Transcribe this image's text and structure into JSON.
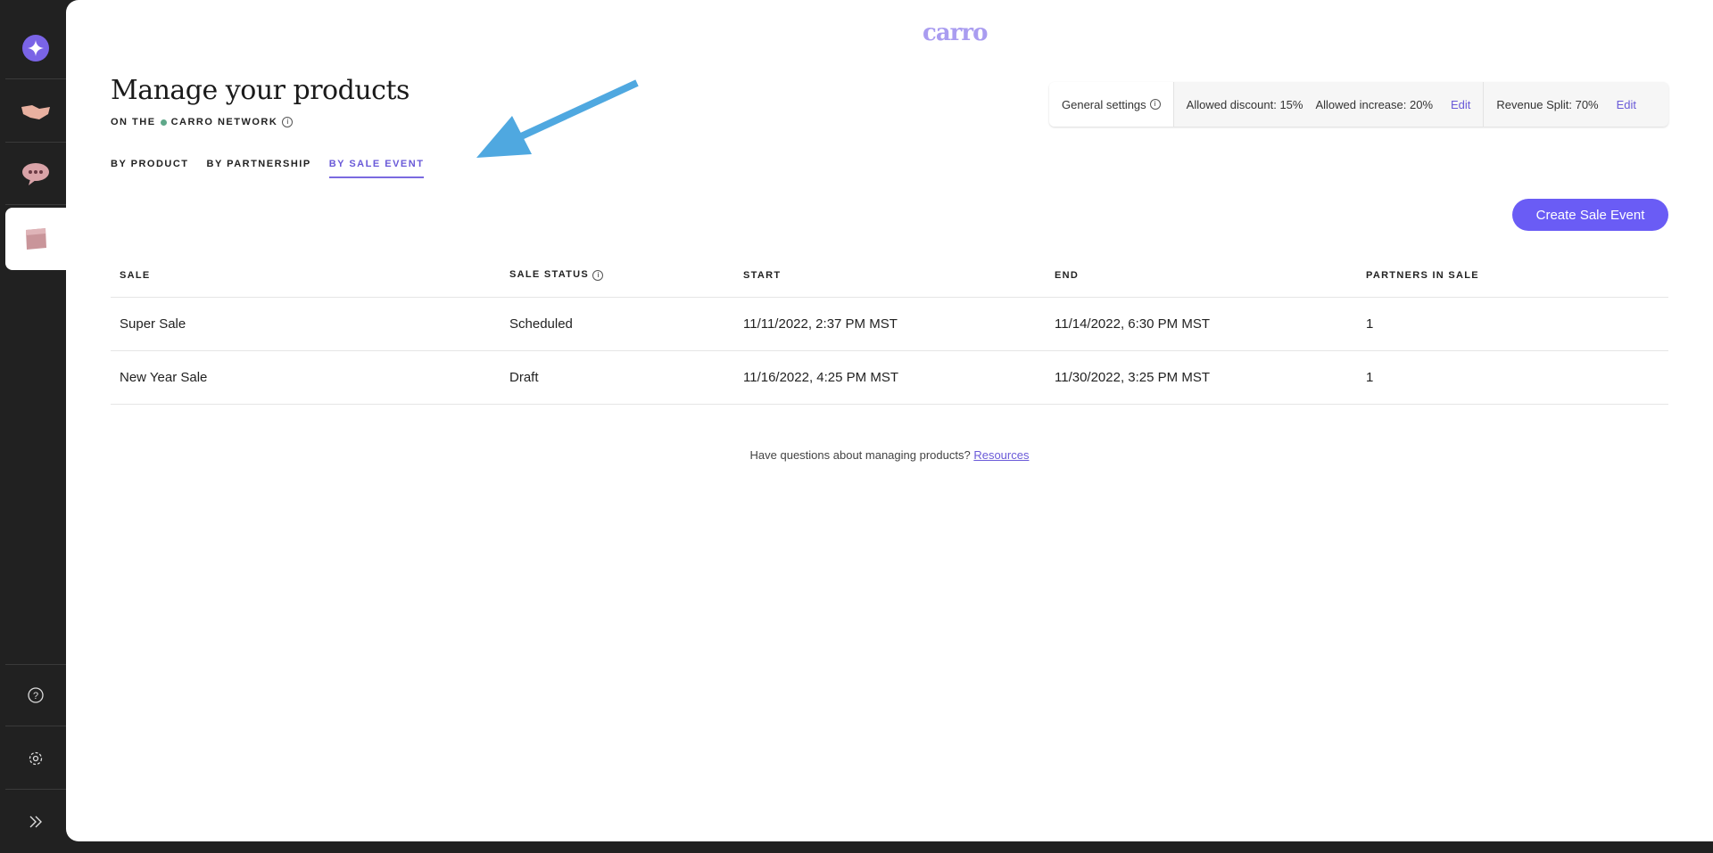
{
  "sidebar": {
    "top_items": [
      "sparkle-icon",
      "handshake-icon",
      "chat-icon",
      "box-icon"
    ],
    "bottom_items": [
      "help-icon",
      "gear-icon",
      "expand-icon"
    ]
  },
  "logo": "carro",
  "header": {
    "title": "Manage your products",
    "subtitle_pre": "ON THE",
    "subtitle_network": "CARRO NETWORK"
  },
  "tabs": [
    {
      "label": "BY PRODUCT"
    },
    {
      "label": "BY PARTNERSHIP"
    },
    {
      "label": "BY SALE EVENT",
      "active": true
    }
  ],
  "settings": {
    "label": "General settings",
    "allowed_discount": "Allowed discount: 15%",
    "allowed_increase": "Allowed increase: 20%",
    "edit1": "Edit",
    "revenue_split": "Revenue Split: 70%",
    "edit2": "Edit"
  },
  "create_button": "Create Sale Event",
  "table": {
    "headers": [
      "SALE",
      "SALE STATUS",
      "START",
      "END",
      "PARTNERS IN SALE"
    ],
    "rows": [
      [
        "Super Sale",
        "Scheduled",
        "11/11/2022, 2:37 PM MST",
        "11/14/2022, 6:30 PM MST",
        "1"
      ],
      [
        "New Year Sale",
        "Draft",
        "11/16/2022, 4:25 PM MST",
        "11/30/2022, 3:25 PM MST",
        "1"
      ]
    ]
  },
  "footer": {
    "text": "Have questions about managing products?",
    "link": "Resources"
  },
  "colors": {
    "accent": "#6a5cf5",
    "arrow": "#4fa8e0"
  }
}
